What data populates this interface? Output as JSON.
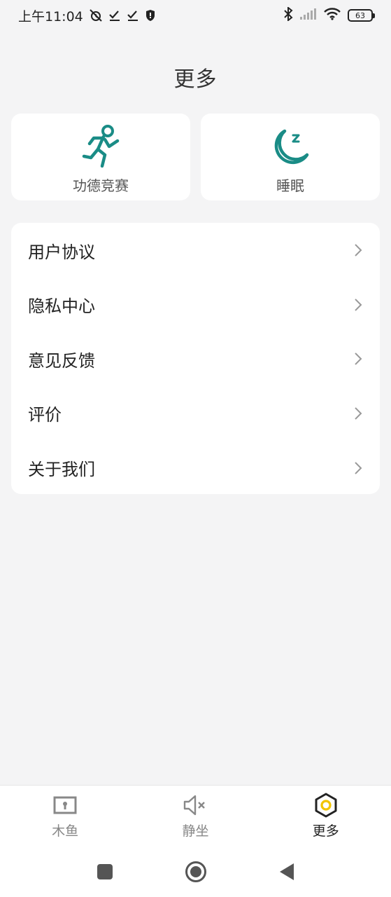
{
  "status_bar": {
    "time": "上午11:04",
    "battery": "63",
    "icons": [
      "alarm-off-icon",
      "check-icon",
      "check-icon",
      "shield-icon",
      "bluetooth-icon",
      "signal-icon",
      "wifi-icon",
      "battery-icon"
    ]
  },
  "page": {
    "title": "更多"
  },
  "cards": [
    {
      "label": "功德竞赛",
      "icon": "running-figure-icon"
    },
    {
      "label": "睡眠",
      "icon": "moon-sleep-icon"
    }
  ],
  "menu": {
    "items": [
      {
        "label": "用户协议"
      },
      {
        "label": "隐私中心"
      },
      {
        "label": "意见反馈"
      },
      {
        "label": "评价"
      },
      {
        "label": "关于我们"
      }
    ]
  },
  "bottom_nav": {
    "tabs": [
      {
        "label": "木鱼",
        "icon": "wooden-fish-icon",
        "active": false
      },
      {
        "label": "静坐",
        "icon": "mute-speaker-icon",
        "active": false
      },
      {
        "label": "更多",
        "icon": "hexagon-icon",
        "active": true
      }
    ]
  },
  "colors": {
    "accent_teal": "#1a8c86",
    "active_yellow": "#f2c500",
    "background": "#f4f4f5",
    "card": "#ffffff"
  }
}
